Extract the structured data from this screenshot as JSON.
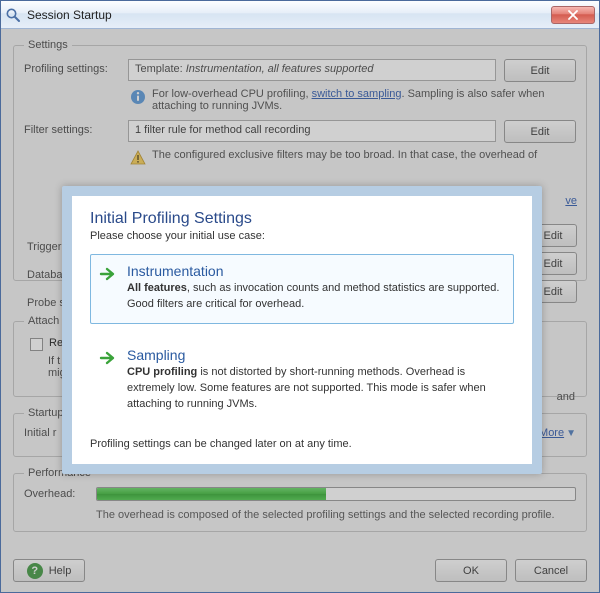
{
  "window": {
    "title": "Session Startup",
    "close_label": "Close"
  },
  "settings_group": {
    "legend": "Settings",
    "profiling_label": "Profiling settings:",
    "profiling_template_prefix": "Template: ",
    "profiling_template_name": "Instrumentation, all features supported",
    "profiling_edit": "Edit",
    "profiling_hint_pre": "For low-overhead CPU profiling, ",
    "profiling_hint_link": "switch to sampling",
    "profiling_hint_post": ". Sampling is also safer when attaching to running JVMs.",
    "filter_label": "Filter settings:",
    "filter_value": "1 filter rule for method call recording",
    "filter_edit": "Edit",
    "filter_warn_pre": "The configured exclusive filters may be too broad. In that case, the overhead of",
    "triggers_label": "Trigger",
    "triggers_edit": "Edit",
    "database_label": "Databa",
    "database_edit": "Edit",
    "probes_label": "Probe s",
    "probes_edit": "Edit"
  },
  "attach_group": {
    "legend": "Attach O",
    "re_label": "Re",
    "line1": "If t",
    "line2": "mig",
    "tail": "and"
  },
  "startup_group": {
    "legend": "Startup",
    "initial_label": "Initial r",
    "more": "More"
  },
  "performance_group": {
    "legend": "Performance",
    "overhead_label": "Overhead:",
    "overhead_percent": 48,
    "note": "The overhead is composed of the selected profiling settings and the selected recording profile."
  },
  "footer": {
    "help": "Help",
    "ok": "OK",
    "cancel": "Cancel"
  },
  "modal": {
    "title": "Initial Profiling Settings",
    "subtitle": "Please choose your initial use case:",
    "opt1_title": "Instrumentation",
    "opt1_desc_bold": "All features",
    "opt1_desc_rest": ", such as invocation counts and method statistics are supported. Good filters are critical for overhead.",
    "opt2_title": "Sampling",
    "opt2_desc_bold": "CPU profiling",
    "opt2_desc_rest": " is not distorted by short-running methods. Overhead is extremely low. Some features are not supported. This mode is safer when attaching to running JVMs.",
    "footer": "Profiling settings can be changed later on at any time."
  },
  "links": {
    "ve": "ve",
    "e_suffix": "e"
  }
}
